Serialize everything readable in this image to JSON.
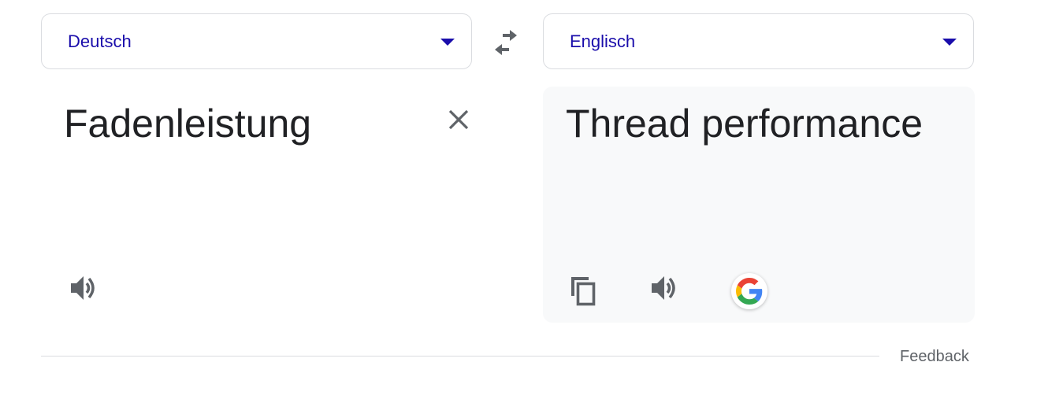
{
  "source": {
    "language": "Deutsch",
    "text": "Fadenleistung"
  },
  "target": {
    "language": "Englisch",
    "text": "Thread performance"
  },
  "footer": {
    "feedback_label": "Feedback"
  },
  "icons": {
    "dropdown": "chevron-down-icon",
    "swap": "swap-languages-icon",
    "clear": "close-icon",
    "speaker": "speaker-icon",
    "copy": "copy-icon",
    "google": "google-logo-icon"
  },
  "colors": {
    "accent": "#1a0dab",
    "icon": "#5f6368",
    "panel_bg": "#f8f9fa"
  }
}
